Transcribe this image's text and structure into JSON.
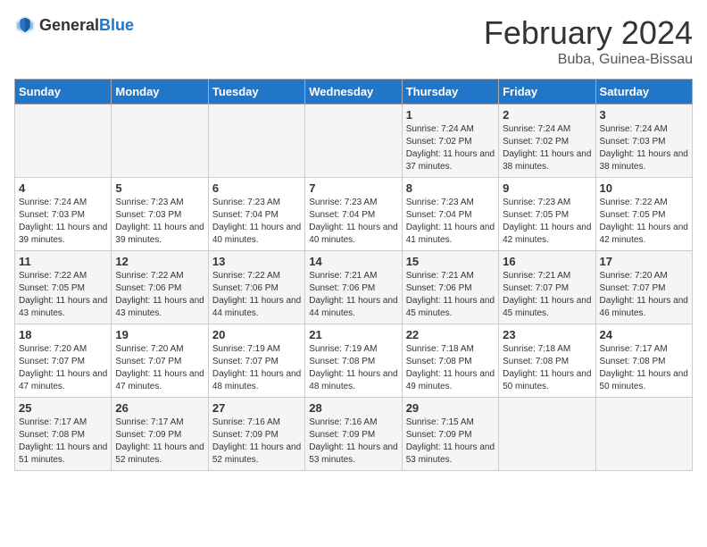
{
  "header": {
    "logo_general": "General",
    "logo_blue": "Blue",
    "main_title": "February 2024",
    "subtitle": "Buba, Guinea-Bissau"
  },
  "calendar": {
    "days_of_week": [
      "Sunday",
      "Monday",
      "Tuesday",
      "Wednesday",
      "Thursday",
      "Friday",
      "Saturday"
    ],
    "weeks": [
      [
        {
          "day": "",
          "info": ""
        },
        {
          "day": "",
          "info": ""
        },
        {
          "day": "",
          "info": ""
        },
        {
          "day": "",
          "info": ""
        },
        {
          "day": "1",
          "info": "Sunrise: 7:24 AM\nSunset: 7:02 PM\nDaylight: 11 hours and 37 minutes."
        },
        {
          "day": "2",
          "info": "Sunrise: 7:24 AM\nSunset: 7:02 PM\nDaylight: 11 hours and 38 minutes."
        },
        {
          "day": "3",
          "info": "Sunrise: 7:24 AM\nSunset: 7:03 PM\nDaylight: 11 hours and 38 minutes."
        }
      ],
      [
        {
          "day": "4",
          "info": "Sunrise: 7:24 AM\nSunset: 7:03 PM\nDaylight: 11 hours and 39 minutes."
        },
        {
          "day": "5",
          "info": "Sunrise: 7:23 AM\nSunset: 7:03 PM\nDaylight: 11 hours and 39 minutes."
        },
        {
          "day": "6",
          "info": "Sunrise: 7:23 AM\nSunset: 7:04 PM\nDaylight: 11 hours and 40 minutes."
        },
        {
          "day": "7",
          "info": "Sunrise: 7:23 AM\nSunset: 7:04 PM\nDaylight: 11 hours and 40 minutes."
        },
        {
          "day": "8",
          "info": "Sunrise: 7:23 AM\nSunset: 7:04 PM\nDaylight: 11 hours and 41 minutes."
        },
        {
          "day": "9",
          "info": "Sunrise: 7:23 AM\nSunset: 7:05 PM\nDaylight: 11 hours and 42 minutes."
        },
        {
          "day": "10",
          "info": "Sunrise: 7:22 AM\nSunset: 7:05 PM\nDaylight: 11 hours and 42 minutes."
        }
      ],
      [
        {
          "day": "11",
          "info": "Sunrise: 7:22 AM\nSunset: 7:05 PM\nDaylight: 11 hours and 43 minutes."
        },
        {
          "day": "12",
          "info": "Sunrise: 7:22 AM\nSunset: 7:06 PM\nDaylight: 11 hours and 43 minutes."
        },
        {
          "day": "13",
          "info": "Sunrise: 7:22 AM\nSunset: 7:06 PM\nDaylight: 11 hours and 44 minutes."
        },
        {
          "day": "14",
          "info": "Sunrise: 7:21 AM\nSunset: 7:06 PM\nDaylight: 11 hours and 44 minutes."
        },
        {
          "day": "15",
          "info": "Sunrise: 7:21 AM\nSunset: 7:06 PM\nDaylight: 11 hours and 45 minutes."
        },
        {
          "day": "16",
          "info": "Sunrise: 7:21 AM\nSunset: 7:07 PM\nDaylight: 11 hours and 45 minutes."
        },
        {
          "day": "17",
          "info": "Sunrise: 7:20 AM\nSunset: 7:07 PM\nDaylight: 11 hours and 46 minutes."
        }
      ],
      [
        {
          "day": "18",
          "info": "Sunrise: 7:20 AM\nSunset: 7:07 PM\nDaylight: 11 hours and 47 minutes."
        },
        {
          "day": "19",
          "info": "Sunrise: 7:20 AM\nSunset: 7:07 PM\nDaylight: 11 hours and 47 minutes."
        },
        {
          "day": "20",
          "info": "Sunrise: 7:19 AM\nSunset: 7:07 PM\nDaylight: 11 hours and 48 minutes."
        },
        {
          "day": "21",
          "info": "Sunrise: 7:19 AM\nSunset: 7:08 PM\nDaylight: 11 hours and 48 minutes."
        },
        {
          "day": "22",
          "info": "Sunrise: 7:18 AM\nSunset: 7:08 PM\nDaylight: 11 hours and 49 minutes."
        },
        {
          "day": "23",
          "info": "Sunrise: 7:18 AM\nSunset: 7:08 PM\nDaylight: 11 hours and 50 minutes."
        },
        {
          "day": "24",
          "info": "Sunrise: 7:17 AM\nSunset: 7:08 PM\nDaylight: 11 hours and 50 minutes."
        }
      ],
      [
        {
          "day": "25",
          "info": "Sunrise: 7:17 AM\nSunset: 7:08 PM\nDaylight: 11 hours and 51 minutes."
        },
        {
          "day": "26",
          "info": "Sunrise: 7:17 AM\nSunset: 7:09 PM\nDaylight: 11 hours and 52 minutes."
        },
        {
          "day": "27",
          "info": "Sunrise: 7:16 AM\nSunset: 7:09 PM\nDaylight: 11 hours and 52 minutes."
        },
        {
          "day": "28",
          "info": "Sunrise: 7:16 AM\nSunset: 7:09 PM\nDaylight: 11 hours and 53 minutes."
        },
        {
          "day": "29",
          "info": "Sunrise: 7:15 AM\nSunset: 7:09 PM\nDaylight: 11 hours and 53 minutes."
        },
        {
          "day": "",
          "info": ""
        },
        {
          "day": "",
          "info": ""
        }
      ]
    ]
  }
}
